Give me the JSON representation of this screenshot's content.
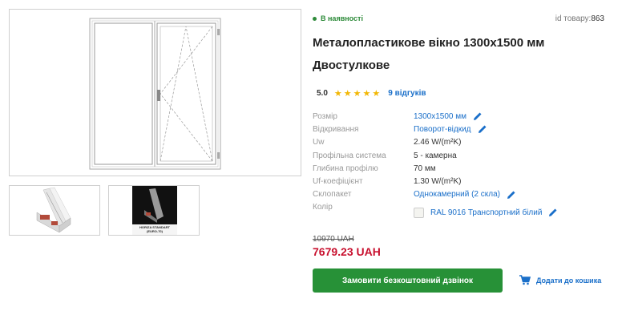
{
  "product": {
    "availability": "В наявності",
    "id_label": "id товару:",
    "id_value": "863",
    "title": "Металопластикове вікно 1300x1500 мм Двостулкове",
    "rating_value": "5.0",
    "stars_count": 5,
    "reviews_label": "9 відгуків"
  },
  "specs": [
    {
      "label": "Розмір",
      "value": "1300x1500 мм"
    },
    {
      "label": "Відкривання",
      "value": "Поворот-відкид"
    },
    {
      "label": "Uw",
      "value": "2.46 W/(m²K)"
    },
    {
      "label": "Профільна система",
      "value": "5 - камерна"
    },
    {
      "label": "Глибина профілю",
      "value": "70 мм"
    },
    {
      "label": "Uf-коефіцієнт",
      "value": "1.30 W/(m²K)"
    },
    {
      "label": "Склопакет",
      "value": "Однокамерний (2 скла)"
    },
    {
      "label": "Колір",
      "value": "RAL 9016 Транспортний білий"
    }
  ],
  "price": {
    "old": "10970 UAH",
    "new": "7679.23 UAH"
  },
  "actions": {
    "callback_label": "Замовити безкоштовний дзвінок",
    "cart_label": "Додати до кошика"
  },
  "thumbnails": {
    "thumb2_caption_line1": "HORIZA STANDART",
    "thumb2_caption_line2": "(EURO-70)"
  },
  "colors": {
    "accent_green": "#279137",
    "link_blue": "#1a6fc9",
    "price_red": "#c8102e",
    "star_yellow": "#f2b705"
  }
}
